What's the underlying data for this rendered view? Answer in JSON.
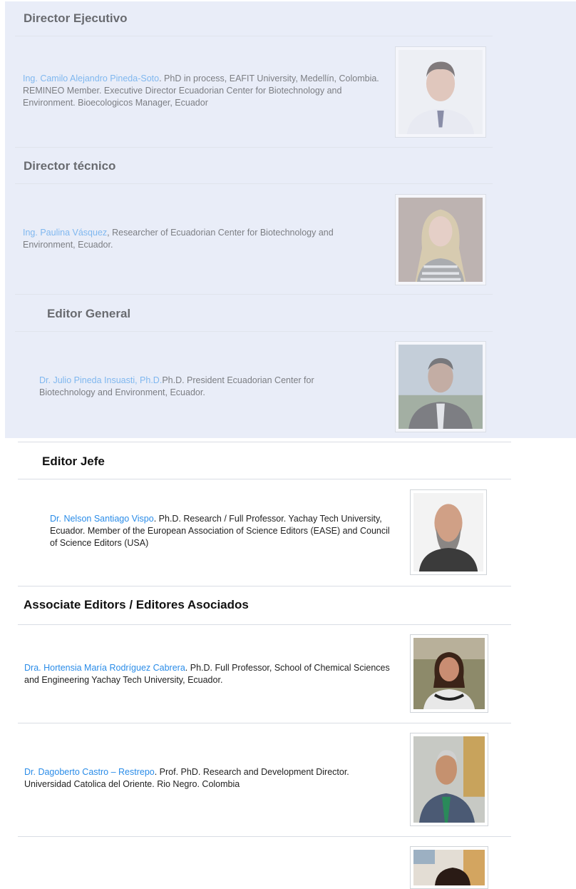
{
  "sections": [
    {
      "heading": "Director Ejecutivo",
      "bio_name": "Ing. Camilo Alejandro Pineda-Soto",
      "bio_text": ". PhD in process, EAFIT University, Medellín, Colombia. REMINEO Member. Executive Director Ecuadorian Center for Biotechnology and Environment. Bioecologicos Manager, Ecuador"
    },
    {
      "heading": "Director técnico",
      "bio_name": "Ing. Paulina Vásquez",
      "bio_text": ", Researcher of Ecuadorian Center for Biotechnology and Environment, Ecuador."
    },
    {
      "heading": "Editor General",
      "bio_name": "Dr. Julio Pineda Insuasti, Ph.D.",
      "bio_text": "Ph.D. President Ecuadorian Center for Biotechnology and Environment, Ecuador."
    },
    {
      "heading": "Editor Jefe",
      "bio_name": "Dr. Nelson Santiago Vispo",
      "bio_text": ". Ph.D. Research / Full Professor. Yachay Tech University, Ecuador. Member of the European Association of Science Editors (EASE) and  Council of Science Editors (USA)"
    },
    {
      "heading": "Associate Editors / Editores Asociados",
      "entries": [
        {
          "bio_name": "Dra. Hortensia María Rodríguez Cabrera",
          "bio_text": ". Ph.D. Full Professor, School of Chemical Sciences and Engineering Yachay Tech University, Ecuador."
        },
        {
          "bio_name": "Dr. Dagoberto Castro – Restrepo",
          "bio_text": ". Prof. PhD. Research and Development Director. Universidad Catolica del Oriente. Rio Negro. Colombia"
        }
      ]
    }
  ]
}
